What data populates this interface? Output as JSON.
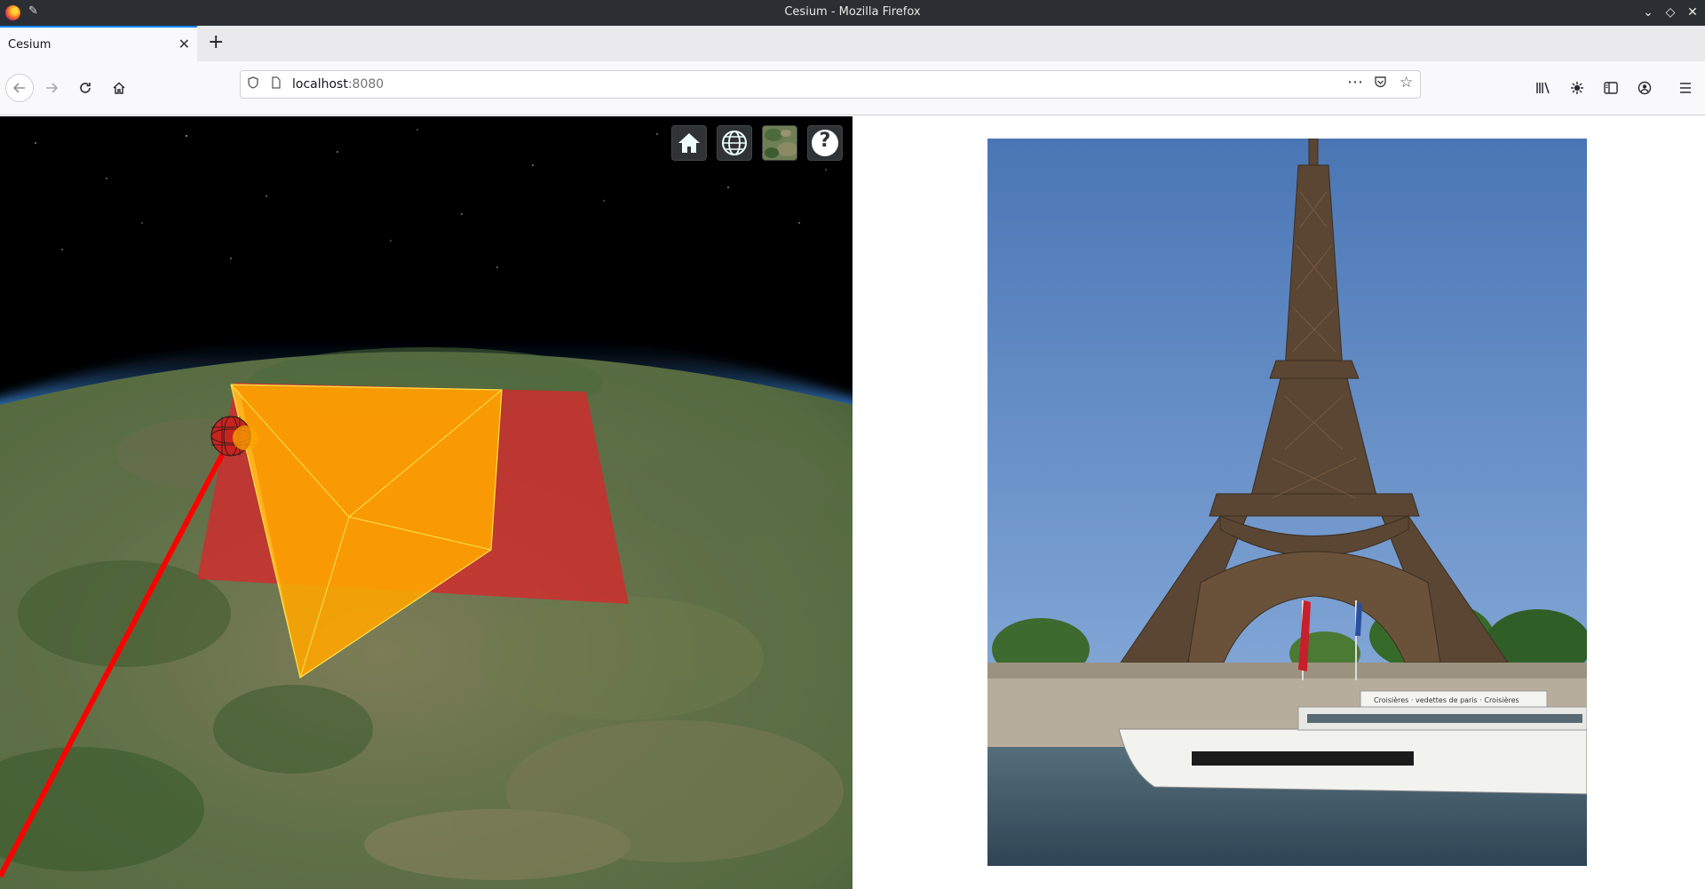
{
  "window": {
    "title": "Cesium - Mozilla Firefox",
    "buttons": [
      "minimize-icon",
      "maximize-icon",
      "close-icon"
    ]
  },
  "tabs": [
    {
      "label": "Cesium",
      "active": true
    }
  ],
  "toolbar": {
    "url_host": "localhost",
    "url_port": ":8080",
    "icons": [
      "back-icon",
      "forward-icon",
      "reload-icon",
      "home-icon",
      "library-icon",
      "extensions-icon",
      "sidebar-icon",
      "account-icon",
      "menu-icon"
    ]
  },
  "cesium": {
    "toolbar_buttons": [
      "home-icon",
      "globe-icon",
      "imagery-picker-icon",
      "help-icon"
    ],
    "help_label": "?",
    "colors": {
      "sky": "#000000",
      "atmosphere": "#8ec9ff",
      "footprint": "#d7282b",
      "pyramid": "#ffa500",
      "track": "#ff0000"
    }
  },
  "photo": {
    "sign_text": "Croisières · vedettes de paris · Croisières",
    "colors": {
      "sky": "#5b86c2",
      "water": "#41586a"
    }
  }
}
